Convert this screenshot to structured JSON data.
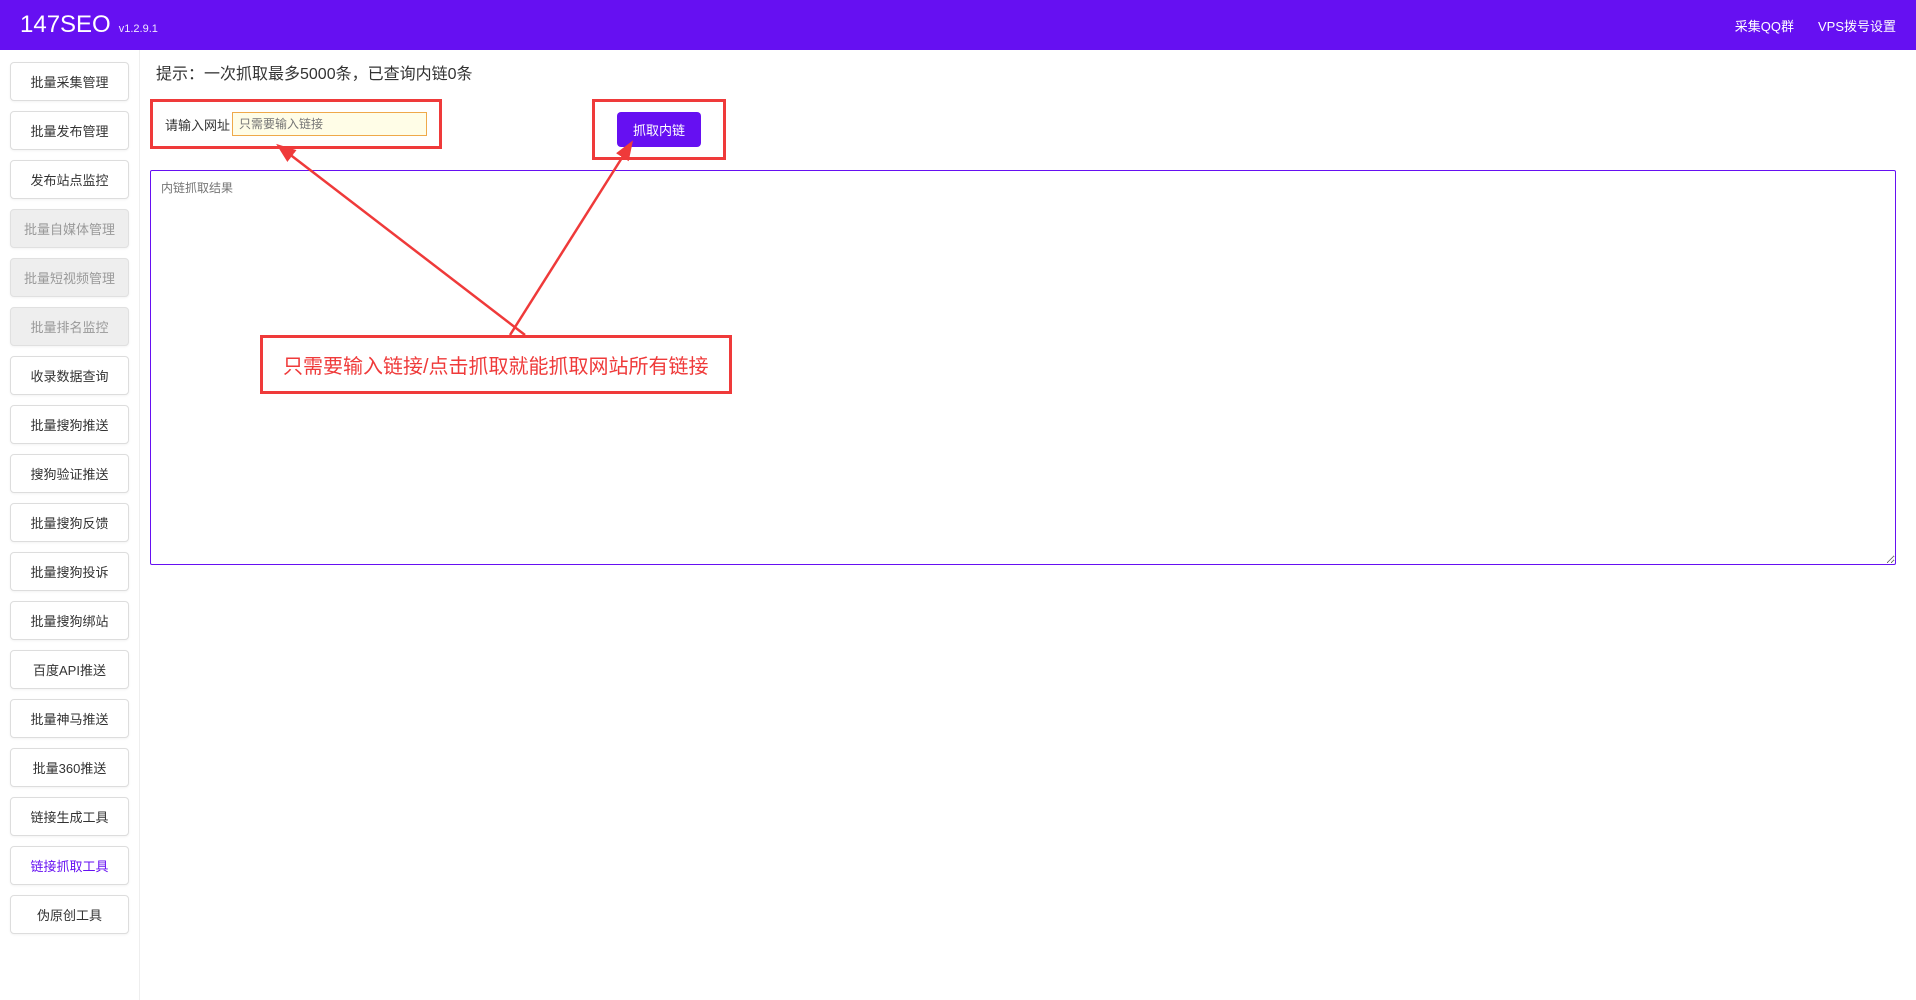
{
  "header": {
    "title": "147SEO",
    "version": "v1.2.9.1",
    "links": {
      "qq_group": "采集QQ群",
      "vps_settings": "VPS拨号设置"
    }
  },
  "sidebar": {
    "items": [
      {
        "label": "批量采集管理",
        "state": "normal"
      },
      {
        "label": "批量发布管理",
        "state": "normal"
      },
      {
        "label": "发布站点监控",
        "state": "normal"
      },
      {
        "label": "批量自媒体管理",
        "state": "disabled"
      },
      {
        "label": "批量短视频管理",
        "state": "disabled"
      },
      {
        "label": "批量排名监控",
        "state": "disabled"
      },
      {
        "label": "收录数据查询",
        "state": "normal"
      },
      {
        "label": "批量搜狗推送",
        "state": "normal"
      },
      {
        "label": "搜狗验证推送",
        "state": "normal"
      },
      {
        "label": "批量搜狗反馈",
        "state": "normal"
      },
      {
        "label": "批量搜狗投诉",
        "state": "normal"
      },
      {
        "label": "批量搜狗绑站",
        "state": "normal"
      },
      {
        "label": "百度API推送",
        "state": "normal"
      },
      {
        "label": "批量神马推送",
        "state": "normal"
      },
      {
        "label": "批量360推送",
        "state": "normal"
      },
      {
        "label": "链接生成工具",
        "state": "normal"
      },
      {
        "label": "链接抓取工具",
        "state": "active"
      },
      {
        "label": "伪原创工具",
        "state": "normal"
      }
    ]
  },
  "main": {
    "tip": "提示：一次抓取最多5000条，已查询内链0条",
    "input_label": "请输入网址",
    "input_placeholder": "只需要输入链接",
    "fetch_button": "抓取内链",
    "result_placeholder": "内链抓取结果",
    "annotation": "只需要输入链接/点击抓取就能抓取网站所有链接"
  },
  "colors": {
    "primary": "#6610f2",
    "annotation": "#ef3a3a"
  }
}
